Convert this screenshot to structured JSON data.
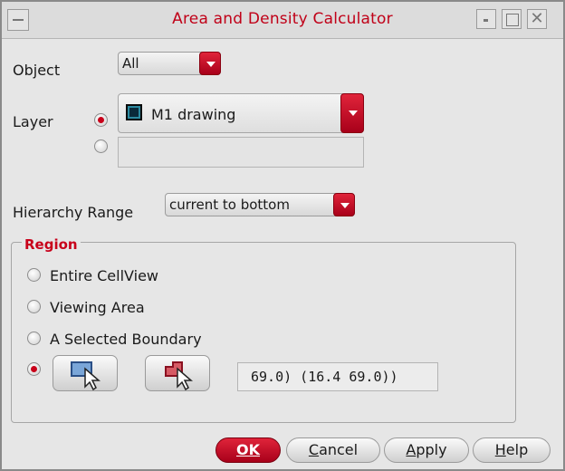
{
  "window": {
    "title": "Area and Density Calculator",
    "controls": [
      "menu-icon",
      "minimize-icon",
      "maximize-icon",
      "close-icon"
    ]
  },
  "object": {
    "label": "Object",
    "value": "All"
  },
  "layer": {
    "label": "Layer",
    "value": "M1 drawing",
    "swatch_color": "#2b8aa0",
    "radio_selected": "layer-select",
    "second_field_value": ""
  },
  "hierarchy": {
    "label": "Hierarchy Range",
    "value": "current to bottom"
  },
  "region": {
    "title": "Region",
    "options": [
      "Entire CellView",
      "Viewing Area",
      "A Selected Boundary"
    ],
    "selected": "coordinates",
    "icons": [
      "select-rectangle-icon",
      "select-polygon-icon"
    ],
    "coordinates": "69.0) (16.4 69.0))"
  },
  "buttons": {
    "ok": {
      "prefix": "",
      "hot": "OK",
      "rest": ""
    },
    "cancel": {
      "prefix": "",
      "hot": "C",
      "rest": "ancel"
    },
    "apply": {
      "prefix": "",
      "hot": "A",
      "rest": "pply"
    },
    "help": {
      "prefix": "",
      "hot": "H",
      "rest": "elp"
    }
  },
  "colors": {
    "accent": "#c8001a",
    "title_text": "#c00018"
  }
}
